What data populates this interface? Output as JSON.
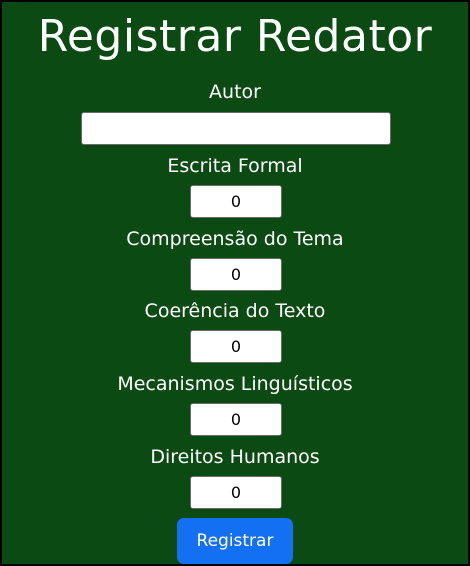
{
  "form": {
    "title": "Registrar Redator",
    "author": {
      "label": "Autor",
      "value": ""
    },
    "fields": [
      {
        "label": "Escrita Formal",
        "value": "0"
      },
      {
        "label": "Compreensão do Tema",
        "value": "0"
      },
      {
        "label": "Coerência do Texto",
        "value": "0"
      },
      {
        "label": "Mecanismos Linguísticos",
        "value": "0"
      },
      {
        "label": "Direitos Humanos",
        "value": "0"
      }
    ],
    "submit_label": "Registrar"
  },
  "colors": {
    "background": "#0b4a12",
    "button": "#1470f2",
    "text": "#ffffff"
  }
}
